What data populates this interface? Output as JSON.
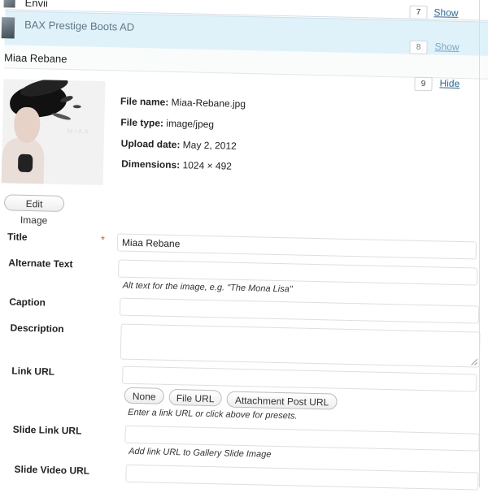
{
  "list": {
    "items": [
      {
        "label": "Envii",
        "order": "7",
        "toggle": "Show"
      },
      {
        "label": "BAX Prestige Boots AD",
        "order": "8",
        "toggle": "Show"
      }
    ]
  },
  "item": {
    "title": "Miaa Rebane",
    "order": "9",
    "toggle": "Hide",
    "art_text": "MIAA",
    "meta": {
      "file_name_label": "File name:",
      "file_name": "Miaa-Rebane.jpg",
      "file_type_label": "File type:",
      "file_type": "image/jpeg",
      "upload_date_label": "Upload date:",
      "upload_date": "May 2, 2012",
      "dimensions_label": "Dimensions:",
      "dimensions": "1024 × 492"
    },
    "edit_image_label": "Edit Image"
  },
  "form": {
    "title_label": "Title",
    "title_required": "*",
    "title_value": "Miaa Rebane",
    "alt_label": "Alternate Text",
    "alt_value": "",
    "alt_help": "Alt text for the image, e.g. \"The Mona Lisa\"",
    "caption_label": "Caption",
    "caption_value": "",
    "description_label": "Description",
    "link_url_label": "Link URL",
    "link_url_value": "",
    "link_presets": [
      "None",
      "File URL",
      "Attachment Post URL"
    ],
    "link_help": "Enter a link URL or click above for presets.",
    "slide_link_label": "Slide Link URL",
    "slide_link_value": "",
    "slide_link_help": "Add link URL to Gallery Slide Image",
    "slide_video_label": "Slide Video URL",
    "slide_video_value": ""
  },
  "colors": {
    "highlight_row": "#dff2fa",
    "link": "#2a6a9a",
    "required": "#d54e21"
  }
}
